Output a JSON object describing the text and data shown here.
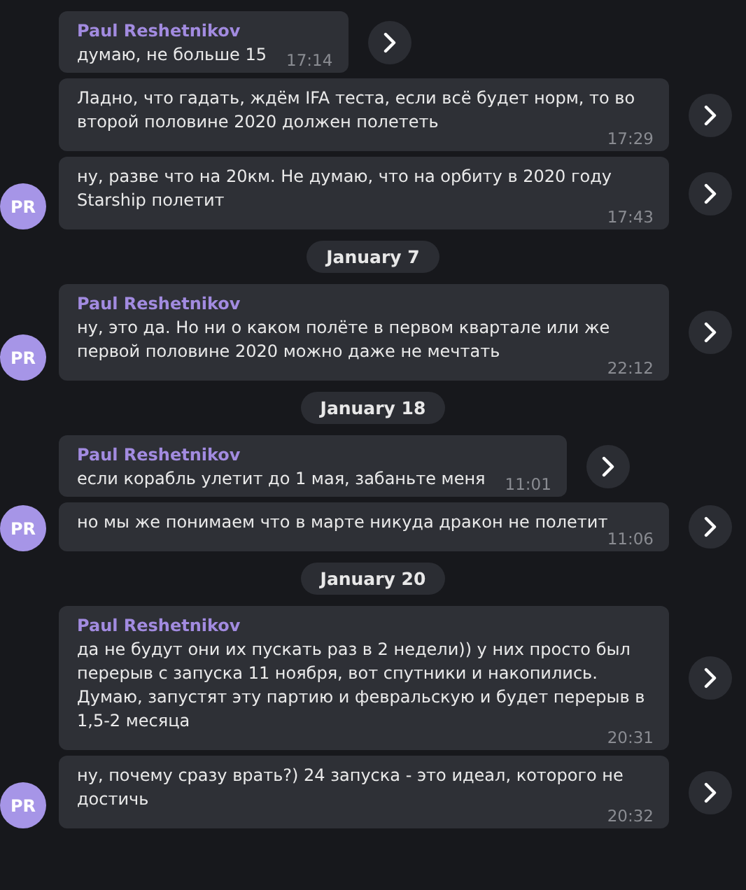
{
  "items": [
    {
      "kind": "group",
      "avatar": "PR",
      "messages": [
        {
          "sender": "Paul Reshetnikov",
          "text": "думаю, не больше 15",
          "time": "17:14"
        },
        {
          "text": "Ладно, что гадать, ждём IFA теста, если всё будет норм, то во второй половине 2020 должен полететь",
          "time": "17:29"
        },
        {
          "text": "ну, разве что на 20км. Не думаю, что на орбиту в 2020 году Starship полетит",
          "time": "17:43"
        }
      ]
    },
    {
      "kind": "date",
      "label": "January 7"
    },
    {
      "kind": "group",
      "avatar": "PR",
      "messages": [
        {
          "sender": "Paul Reshetnikov",
          "text": "ну, это да. Но ни о каком полёте в первом квартале или же первой половине 2020 можно даже не мечтать",
          "time": "22:12"
        }
      ]
    },
    {
      "kind": "date",
      "label": "January 18"
    },
    {
      "kind": "group",
      "avatar": "PR",
      "messages": [
        {
          "sender": "Paul Reshetnikov",
          "text": "если корабль улетит до 1 мая, забаньте меня",
          "time": "11:01"
        },
        {
          "text": "но мы же понимаем что в марте никуда дракон не полетит",
          "time": "11:06"
        }
      ]
    },
    {
      "kind": "date",
      "label": "January 20"
    },
    {
      "kind": "group",
      "avatar": "PR",
      "messages": [
        {
          "sender": "Paul Reshetnikov",
          "text": "да не будут они их пускать раз в 2 недели)) у них просто был перерыв с запуска 11 ноября, вот спутники и накопились. Думаю, запустят эту партию и февральскую и будет перерыв в 1,5-2 месяца",
          "time": "20:31"
        },
        {
          "text": "ну, почему сразу врать?) 24 запуска - это идеал, которого не достичь",
          "time": "20:32"
        }
      ]
    }
  ]
}
